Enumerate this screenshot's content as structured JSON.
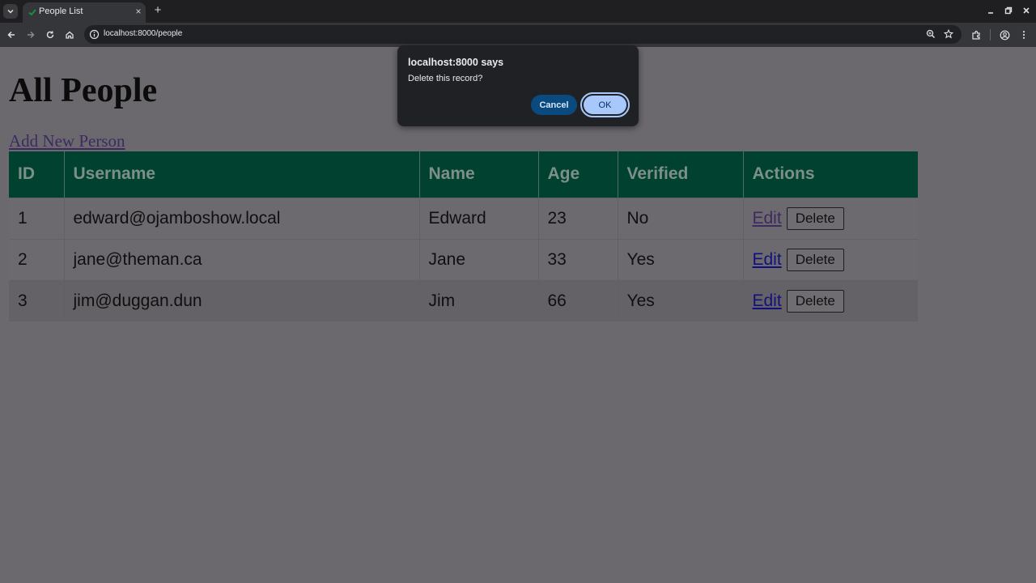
{
  "browser": {
    "tab_title": "People List",
    "url": "localhost:8000/people",
    "new_tab_symbol": "+",
    "tab_close_symbol": "×"
  },
  "page": {
    "title": "All People",
    "add_link": "Add New Person"
  },
  "table": {
    "headers": [
      "ID",
      "Username",
      "Name",
      "Age",
      "Verified",
      "Actions"
    ],
    "rows": [
      {
        "id": "1",
        "username": "edward@ojamboshow.local",
        "name": "Edward",
        "age": "23",
        "verified": "No",
        "edit": "Edit",
        "delete": "Delete"
      },
      {
        "id": "2",
        "username": "jane@theman.ca",
        "name": "Jane",
        "age": "33",
        "verified": "Yes",
        "edit": "Edit",
        "delete": "Delete"
      },
      {
        "id": "3",
        "username": "jim@duggan.dun",
        "name": "Jim",
        "age": "66",
        "verified": "Yes",
        "edit": "Edit",
        "delete": "Delete"
      }
    ]
  },
  "dialog": {
    "title": "localhost:8000 says",
    "message": "Delete this record?",
    "cancel_label": "Cancel",
    "ok_label": "OK"
  },
  "colors": {
    "header_bg": "#00412f",
    "dialog_bg": "#202124",
    "ok_button": "#a8c7fa",
    "cancel_button": "#0b4a7f"
  }
}
